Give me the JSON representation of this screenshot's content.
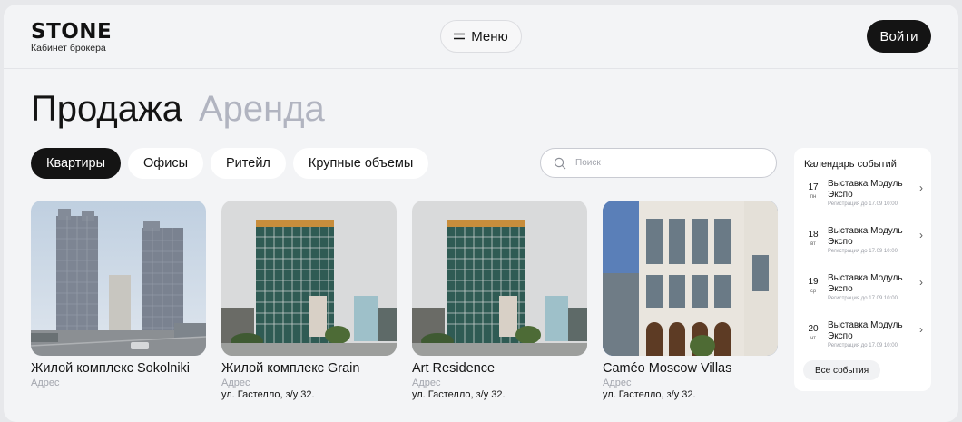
{
  "header": {
    "logo_word": "STONE",
    "logo_sub": "Кабинет брокера",
    "menu_label": "Меню",
    "login_label": "Войти"
  },
  "deal_tabs": [
    {
      "label": "Продажа",
      "active": true
    },
    {
      "label": "Аренда",
      "active": false
    }
  ],
  "filters": [
    {
      "label": "Квартиры",
      "active": true
    },
    {
      "label": "Офисы",
      "active": false
    },
    {
      "label": "Ритейл",
      "active": false
    },
    {
      "label": "Крупные объемы",
      "active": false
    }
  ],
  "search": {
    "placeholder": "Поиск",
    "icon": "search-icon"
  },
  "projects": [
    {
      "title": "Жилой комплекс Sokolniki",
      "address_label": "Адрес",
      "address": ""
    },
    {
      "title": "Жилой комплекс Grain",
      "address_label": "Адрес",
      "address": "ул. Гастелло, з/у 32."
    },
    {
      "title": "Art Residence",
      "address_label": "Адрес",
      "address": "ул. Гастелло, з/у 32."
    },
    {
      "title": "Caméo Moscow Villas",
      "address_label": "Адрес",
      "address": "ул. Гастелло, з/у 32."
    }
  ],
  "calendar": {
    "title": "Календарь событий",
    "events": [
      {
        "day": "17",
        "dow": "пн",
        "name": "Выставка Модуль Экспо",
        "registration": "Регистрация до 17.09 10:00"
      },
      {
        "day": "18",
        "dow": "вт",
        "name": "Выставка Модуль Экспо",
        "registration": "Регистрация до 17.09 10:00"
      },
      {
        "day": "19",
        "dow": "ср",
        "name": "Выставка Модуль Экспо",
        "registration": "Регистрация до 17.09 10:00"
      },
      {
        "day": "20",
        "dow": "чт",
        "name": "Выставка Модуль Экспо",
        "registration": "Регистрация до 17.09 10:00"
      }
    ],
    "all_label": "Все события"
  },
  "colors": {
    "accent": "#141414",
    "muted_text": "#b1b4c0",
    "page_bg": "#f3f4f6"
  }
}
